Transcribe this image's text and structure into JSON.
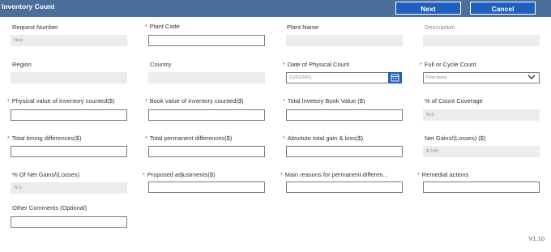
{
  "header": {
    "title": "Inventory Count",
    "next_label": "Next",
    "cancel_label": "Cancel"
  },
  "fields": {
    "request_number": {
      "label": "Request Number",
      "value": "New"
    },
    "plant_code": {
      "label": "Plant Code",
      "value": ""
    },
    "plant_name": {
      "label": "Plant Name",
      "value": ""
    },
    "description": {
      "label": "Description",
      "value": ""
    },
    "region": {
      "label": "Region",
      "value": ""
    },
    "country": {
      "label": "Country",
      "value": ""
    },
    "date_of_physical_count": {
      "label": "Date of Physical Count",
      "value": "12/31/2001"
    },
    "full_or_cycle_count": {
      "label": "Full or Cycle Count",
      "placeholder": "Find items"
    },
    "physical_value": {
      "label": "Physical value of inventory counted($)",
      "value": ""
    },
    "book_value": {
      "label": "Book value of inventory counted($)",
      "value": ""
    },
    "total_book_value": {
      "label": "Total Invetory Book Value ($)",
      "value": ""
    },
    "count_coverage": {
      "label": "% of Count Coverage",
      "value": "% 0"
    },
    "timing_differences": {
      "label": "Total timing differences($)",
      "value": ""
    },
    "permanent_differences": {
      "label": "Total permanent differences($)",
      "value": ""
    },
    "absolute_gain_loss": {
      "label": "Absolute total gain & loss($)",
      "value": ""
    },
    "net_gains": {
      "label": "Net Gains/(Losses) ($)",
      "value": "$ 0.00"
    },
    "pct_net_gains": {
      "label": "% Of Net Gains/(Losses)",
      "value": "% 0"
    },
    "proposed_adjustments": {
      "label": "Proposed adjustments($)",
      "value": ""
    },
    "main_reasons": {
      "label": "Main reasons for permanent differen...",
      "value": ""
    },
    "remedial_actions": {
      "label": "Remedial actions",
      "value": ""
    },
    "other_comments": {
      "label": "Other Comments (Optional)",
      "value": ""
    }
  },
  "required_marker": "*",
  "version": "V1.10",
  "icons": {
    "calendar": "calendar-icon",
    "dropdown": "chevron-down-icon"
  },
  "colors": {
    "header_bg": "#4a6f9a",
    "button_bg": "#1f5fbf",
    "required": "#c0392b"
  }
}
